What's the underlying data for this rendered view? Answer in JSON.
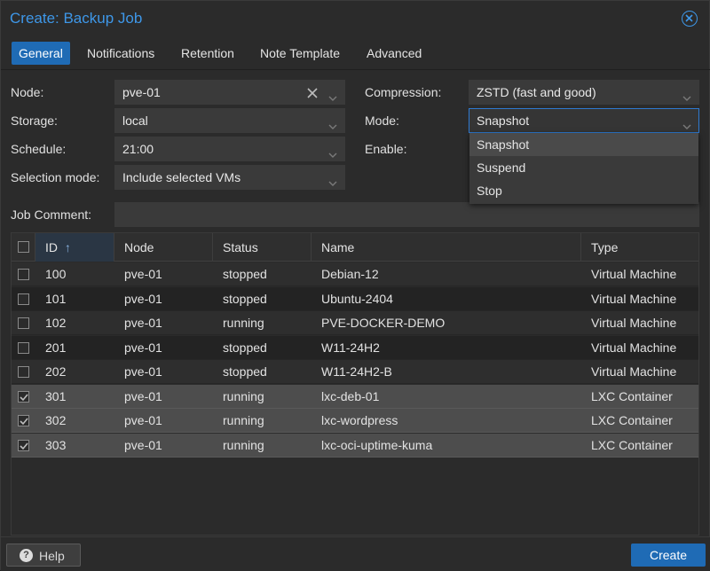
{
  "window": {
    "title": "Create: Backup Job"
  },
  "tabs": [
    "General",
    "Notifications",
    "Retention",
    "Note Template",
    "Advanced"
  ],
  "form": {
    "node_label": "Node:",
    "node_value": "pve-01",
    "storage_label": "Storage:",
    "storage_value": "local",
    "schedule_label": "Schedule:",
    "schedule_value": "21:00",
    "selection_label": "Selection mode:",
    "selection_value": "Include selected VMs",
    "compression_label": "Compression:",
    "compression_value": "ZSTD (fast and good)",
    "mode_label": "Mode:",
    "mode_value": "Snapshot",
    "enable_label": "Enable:",
    "comment_label": "Job Comment:",
    "comment_value": ""
  },
  "mode_dropdown": {
    "options": [
      "Snapshot",
      "Suspend",
      "Stop"
    ],
    "selected": "Snapshot"
  },
  "grid": {
    "columns": [
      "ID",
      "Node",
      "Status",
      "Name",
      "Type"
    ],
    "sort_indicator": "↑",
    "rows": [
      {
        "checked": false,
        "id": "100",
        "node": "pve-01",
        "status": "stopped",
        "name": "Debian-12",
        "type": "Virtual Machine"
      },
      {
        "checked": false,
        "id": "101",
        "node": "pve-01",
        "status": "stopped",
        "name": "Ubuntu-2404",
        "type": "Virtual Machine"
      },
      {
        "checked": false,
        "id": "102",
        "node": "pve-01",
        "status": "running",
        "name": "PVE-DOCKER-DEMO",
        "type": "Virtual Machine"
      },
      {
        "checked": false,
        "id": "201",
        "node": "pve-01",
        "status": "stopped",
        "name": "W11-24H2",
        "type": "Virtual Machine"
      },
      {
        "checked": false,
        "id": "202",
        "node": "pve-01",
        "status": "stopped",
        "name": "W11-24H2-B",
        "type": "Virtual Machine"
      },
      {
        "checked": true,
        "id": "301",
        "node": "pve-01",
        "status": "running",
        "name": "lxc-deb-01",
        "type": "LXC Container"
      },
      {
        "checked": true,
        "id": "302",
        "node": "pve-01",
        "status": "running",
        "name": "lxc-wordpress",
        "type": "LXC Container"
      },
      {
        "checked": true,
        "id": "303",
        "node": "pve-01",
        "status": "running",
        "name": "lxc-oci-uptime-kuma",
        "type": "LXC Container"
      }
    ]
  },
  "footer": {
    "help_label": "Help",
    "help_icon": "?",
    "create_label": "Create"
  },
  "colors": {
    "accent": "#3e97e8",
    "primary_button": "#1f6bb5"
  }
}
